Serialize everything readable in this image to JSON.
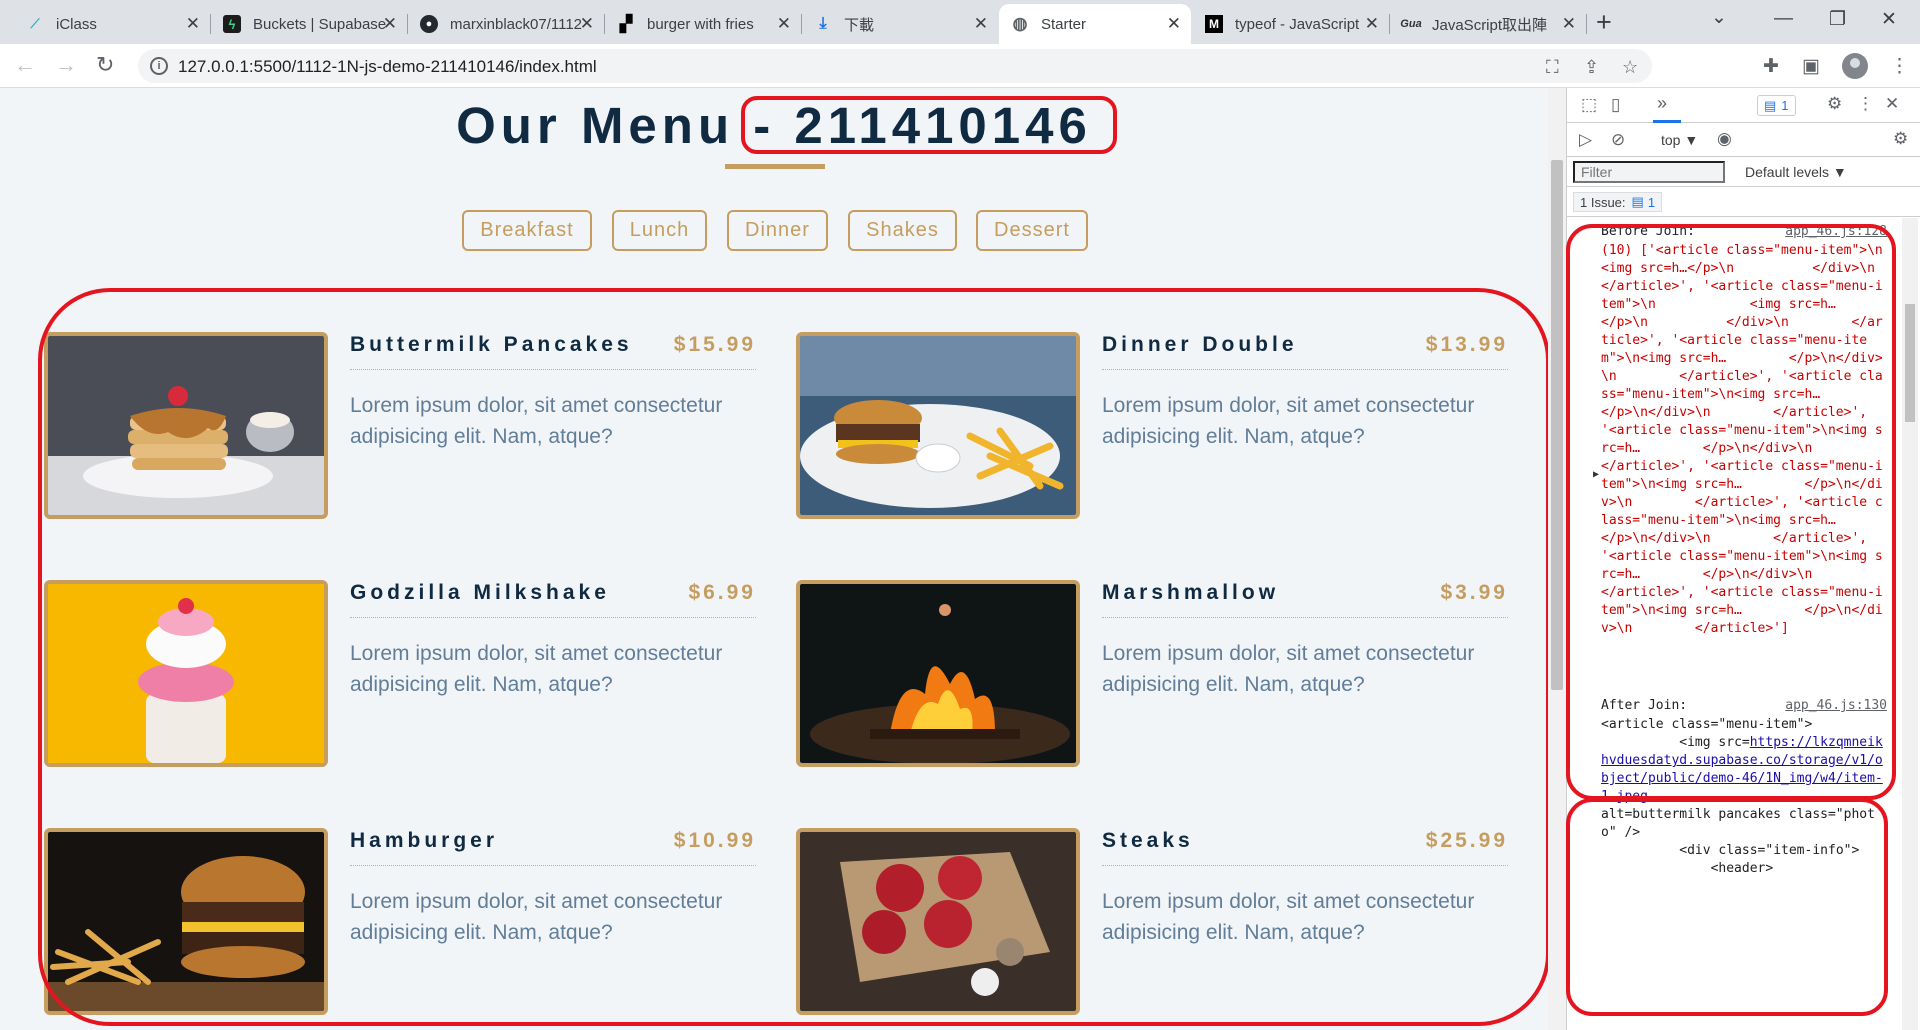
{
  "browser": {
    "tabs": [
      {
        "title": "iClass",
        "favicon": "iclass-icon",
        "active": false
      },
      {
        "title": "Buckets | Supabase",
        "favicon": "supabase-icon",
        "active": false
      },
      {
        "title": "marxinblack07/1112",
        "favicon": "github-icon",
        "active": false
      },
      {
        "title": "burger with fries",
        "favicon": "unsplash-icon",
        "active": false
      },
      {
        "title": "下載",
        "favicon": "download-icon",
        "active": false
      },
      {
        "title": "Starter",
        "favicon": "globe-icon",
        "active": true
      },
      {
        "title": "typeof - JavaScript",
        "favicon": "mdn-icon",
        "active": false
      },
      {
        "title": "JavaScript取出陣",
        "favicon": "gua-icon",
        "active": false
      }
    ],
    "url": "127.0.0.1:5500/1112-1N-js-demo-211410146/index.html"
  },
  "page": {
    "title": "Our Menu - 211410146",
    "filters": [
      "Breakfast",
      "Lunch",
      "Dinner",
      "Shakes",
      "Dessert"
    ],
    "menu_items": [
      {
        "name": "Buttermilk Pancakes",
        "price": "$15.99",
        "desc": "Lorem ipsum dolor, sit amet consectetur adipisicing elit. Nam, atque?",
        "image": "pancakes"
      },
      {
        "name": "Dinner Double",
        "price": "$13.99",
        "desc": "Lorem ipsum dolor, sit amet consectetur adipisicing elit. Nam, atque?",
        "image": "burger-fries-plate"
      },
      {
        "name": "Godzilla Milkshake",
        "price": "$6.99",
        "desc": "Lorem ipsum dolor, sit amet consectetur adipisicing elit. Nam, atque?",
        "image": "milkshake"
      },
      {
        "name": "Marshmallow",
        "price": "$3.99",
        "desc": "Lorem ipsum dolor, sit amet consectetur adipisicing elit. Nam, atque?",
        "image": "campfire"
      },
      {
        "name": "Hamburger",
        "price": "$10.99",
        "desc": "Lorem ipsum dolor, sit amet consectetur adipisicing elit. Nam, atque?",
        "image": "hamburger"
      },
      {
        "name": "Steaks",
        "price": "$25.99",
        "desc": "Lorem ipsum dolor, sit amet consectetur adipisicing elit. Nam, atque?",
        "image": "steaks"
      }
    ]
  },
  "devtools": {
    "issues_badge": "1",
    "context": "top",
    "filter_placeholder": "Filter",
    "levels": "Default levels",
    "issues_text": "1 Issue:",
    "issues_count": "1",
    "logs": [
      {
        "label": "Before Join:",
        "source": "app_46.js:128",
        "text": "(10) ['<article class=\"menu-item\">\\n            <img src=h…</p>\\n          </div>\\n        </article>', '<article class=\"menu-item\">\\n            <img src=h…        </p>\\n          </div>\\n        </article>', '<article class=\"menu-item\">\\n<img src=h…        </p>\\n</div>\\n        </article>', '<article class=\"menu-item\">\\n<img src=h…        </p>\\n</div>\\n        </article>', '<article class=\"menu-item\">\\n<img src=h…        </p>\\n</div>\\n        </article>', '<article class=\"menu-item\">\\n<img src=h…        </p>\\n</div>\\n        </article>', '<article class=\"menu-item\">\\n<img src=h…        </p>\\n</div>\\n        </article>', '<article class=\"menu-item\">\\n<img src=h…        </p>\\n</div>\\n        </article>', '<article class=\"menu-item\">\\n<img src=h…        </p>\\n</div>\\n        </article>']"
      },
      {
        "label": "After Join:",
        "source": "app_46.js:130",
        "line1": "<article class=\"menu-item\">",
        "line2": "          <img src=",
        "link": "https://lkzqmneikhvduesdatyd.supabase.co/storage/v1/object/public/demo-46/1N_img/w4/item-1.jpeg",
        "line3": "alt=buttermilk pancakes class=\"photo\" />",
        "line4": "          <div class=\"item-info\">",
        "line5": "              <header>"
      }
    ]
  }
}
